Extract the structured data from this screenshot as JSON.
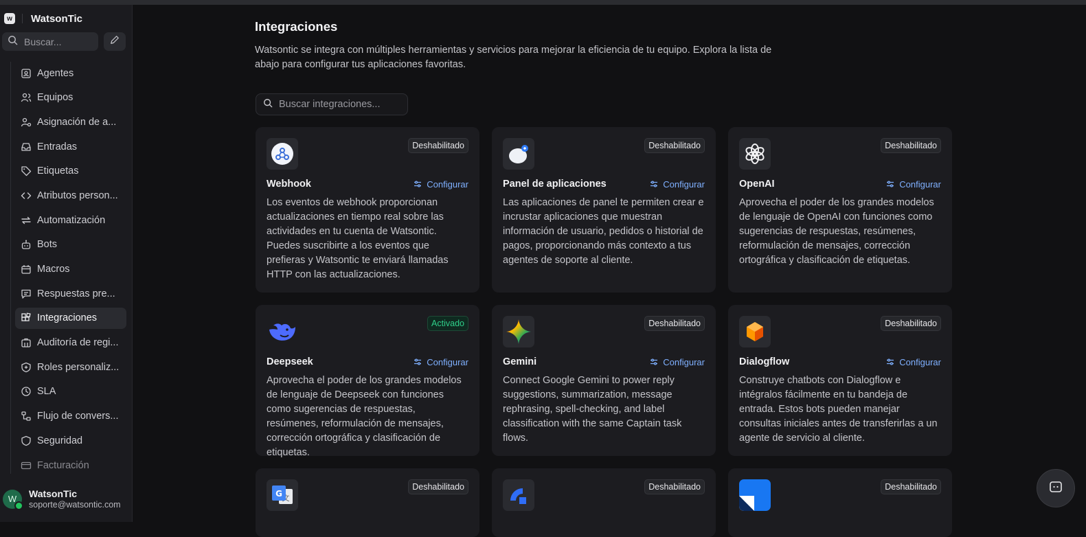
{
  "app": {
    "name": "WatsonTic"
  },
  "sidebar": {
    "search_placeholder": "Buscar...",
    "items": [
      {
        "label": "Agentes",
        "icon": "agent-icon"
      },
      {
        "label": "Equipos",
        "icon": "users-icon"
      },
      {
        "label": "Asignación de a...",
        "icon": "user-assign-icon"
      },
      {
        "label": "Entradas",
        "icon": "inbox-icon"
      },
      {
        "label": "Etiquetas",
        "icon": "tag-icon"
      },
      {
        "label": "Atributos person...",
        "icon": "code-icon"
      },
      {
        "label": "Automatización",
        "icon": "automation-icon"
      },
      {
        "label": "Bots",
        "icon": "bot-icon"
      },
      {
        "label": "Macros",
        "icon": "macros-icon"
      },
      {
        "label": "Respuestas pre...",
        "icon": "canned-response-icon"
      },
      {
        "label": "Integraciones",
        "icon": "integrations-icon",
        "active": true
      },
      {
        "label": "Auditoría de regi...",
        "icon": "audit-icon"
      },
      {
        "label": "Roles personaliz...",
        "icon": "shield-plus-icon"
      },
      {
        "label": "SLA",
        "icon": "clock-icon"
      },
      {
        "label": "Flujo de convers...",
        "icon": "flow-icon"
      },
      {
        "label": "Seguridad",
        "icon": "shield-icon"
      },
      {
        "label": "Facturación",
        "icon": "card-icon"
      }
    ],
    "user": {
      "initial": "W",
      "name": "WatsonTic",
      "email": "soporte@watsontic.com"
    }
  },
  "main": {
    "title": "Integraciones",
    "description": "Watsontic se integra con múltiples herramientas y servicios para mejorar la eficiencia de tu equipo. Explora la lista de abajo para configurar tus aplicaciones favoritas.",
    "search_placeholder": "Buscar integraciones...",
    "configure_label": "Configurar",
    "cards": [
      {
        "name": "Webhook",
        "status": "Deshabilitado",
        "icon": "webhook-icon",
        "description": "Los eventos de webhook proporcionan actualizaciones en tiempo real sobre las actividades en tu cuenta de Watsontic. Puedes suscribirte a los eventos que prefieras y Watsontic te enviará llamadas HTTP con las actualizaciones."
      },
      {
        "name": "Panel de aplicaciones",
        "status": "Deshabilitado",
        "icon": "dashboard-apps-icon",
        "description": "Las aplicaciones de panel te permiten crear e incrustar aplicaciones que muestran información de usuario, pedidos o historial de pagos, proporcionando más contexto a tus agentes de soporte al cliente."
      },
      {
        "name": "OpenAI",
        "status": "Deshabilitado",
        "icon": "openai-icon",
        "description": "Aprovecha el poder de los grandes modelos de lenguaje de OpenAI con funciones como sugerencias de respuestas, resúmenes, reformulación de mensajes, corrección ortográfica y clasificación de etiquetas."
      },
      {
        "name": "Deepseek",
        "status": "Activado",
        "icon": "deepseek-icon",
        "description": "Aprovecha el poder de los grandes modelos de lenguaje de Deepseek con funciones como sugerencias de respuestas, resúmenes, reformulación de mensajes, corrección ortográfica y clasificación de etiquetas."
      },
      {
        "name": "Gemini",
        "status": "Deshabilitado",
        "icon": "gemini-icon",
        "description": "Connect Google Gemini to power reply suggestions, summarization, message rephrasing, spell-checking, and label classification with the same Captain task flows."
      },
      {
        "name": "Dialogflow",
        "status": "Deshabilitado",
        "icon": "dialogflow-icon",
        "description": "Construye chatbots con Dialogflow e intégralos fácilmente en tu bandeja de entrada. Estos bots pueden manejar consultas iniciales antes de transferirlas a un agente de servicio al cliente."
      }
    ],
    "cards_partial": [
      {
        "status": "Deshabilitado",
        "icon": "google-translate-icon"
      },
      {
        "status": "Deshabilitado",
        "icon": "linear-icon"
      },
      {
        "status": "Deshabilitado",
        "icon": "notion-icon"
      }
    ]
  },
  "colors": {
    "accent": "#7fb0ff",
    "enabled": "#2fd08a",
    "background": "#111113",
    "card": "#1c1c20"
  }
}
